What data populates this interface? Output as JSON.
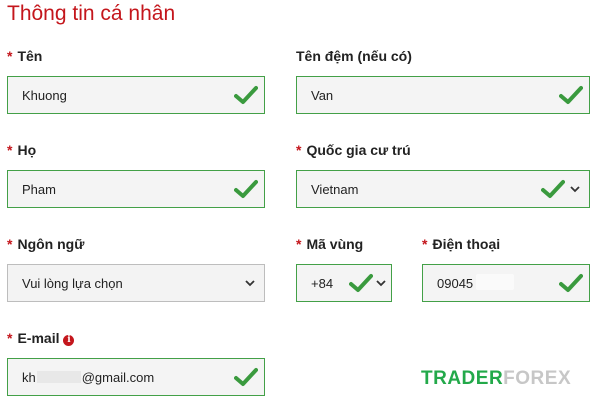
{
  "page_title": "Thông tin cá nhân",
  "required_mark": "*",
  "brand": {
    "part1": "TRADER",
    "part2": "FOREX"
  },
  "colors": {
    "accent_red": "#c4161c",
    "valid_green": "#43a047"
  },
  "fields": {
    "first_name": {
      "label": "Tên",
      "value": "Khuong"
    },
    "middle_name": {
      "label": "Tên đệm (nếu có)",
      "value": "Van"
    },
    "last_name": {
      "label": "Họ",
      "value": "Pham"
    },
    "country": {
      "label": "Quốc gia cư trú",
      "value": "Vietnam"
    },
    "language": {
      "label": "Ngôn ngữ",
      "value": "Vui lòng lựa chọn"
    },
    "area_code": {
      "label": "Mã vùng",
      "value": "+84"
    },
    "phone": {
      "label": "Điện thoại",
      "value": "09045"
    },
    "email": {
      "label": "E-mail",
      "value_start": "kh",
      "value_end": "@gmail.com",
      "info_icon": "i"
    }
  },
  "icons": [
    "check-icon",
    "chevron-down-icon",
    "info-icon"
  ]
}
